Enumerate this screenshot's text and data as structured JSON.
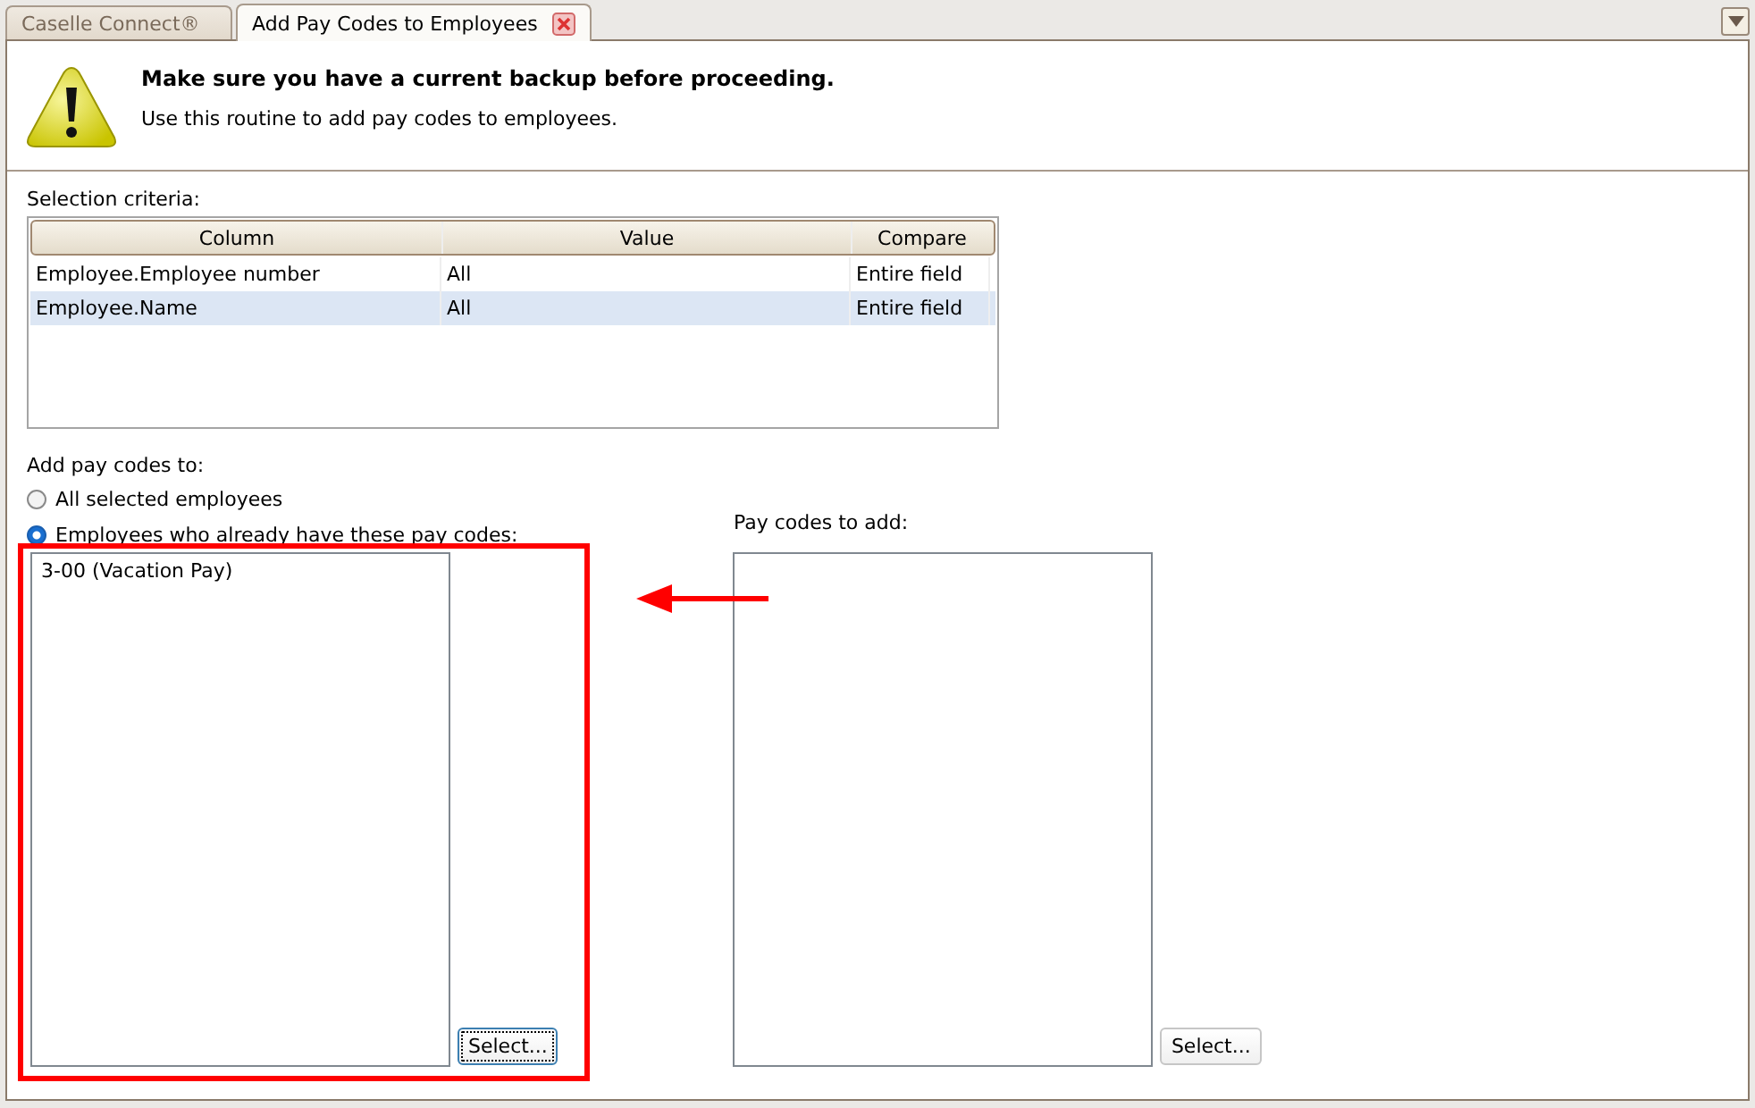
{
  "tabs": [
    {
      "label": "Caselle Connect®",
      "selected": false,
      "closable": false
    },
    {
      "label": "Add Pay Codes to Employees",
      "selected": true,
      "closable": true
    }
  ],
  "header": {
    "title": "Make sure you have a current backup before proceeding.",
    "description": "Use this routine to add pay codes to employees."
  },
  "selection_criteria": {
    "label": "Selection criteria:",
    "columns": [
      "Column",
      "Value",
      "Compare"
    ],
    "rows": [
      {
        "cells": [
          "Employee.Employee number",
          "All",
          "Entire field"
        ],
        "selected": false
      },
      {
        "cells": [
          "Employee.Name",
          "All",
          "Entire field"
        ],
        "selected": true
      }
    ]
  },
  "add_to": {
    "label": "Add pay codes to:",
    "options": [
      {
        "label": "All selected employees",
        "selected": false
      },
      {
        "label": "Employees who already have these pay codes:",
        "selected": true
      }
    ]
  },
  "existing_codes": {
    "items": [
      "3-00 (Vacation Pay)"
    ],
    "button": "Select...",
    "focused": true
  },
  "codes_to_add": {
    "label": "Pay codes to add:",
    "button": "Select...",
    "focused": false
  }
}
